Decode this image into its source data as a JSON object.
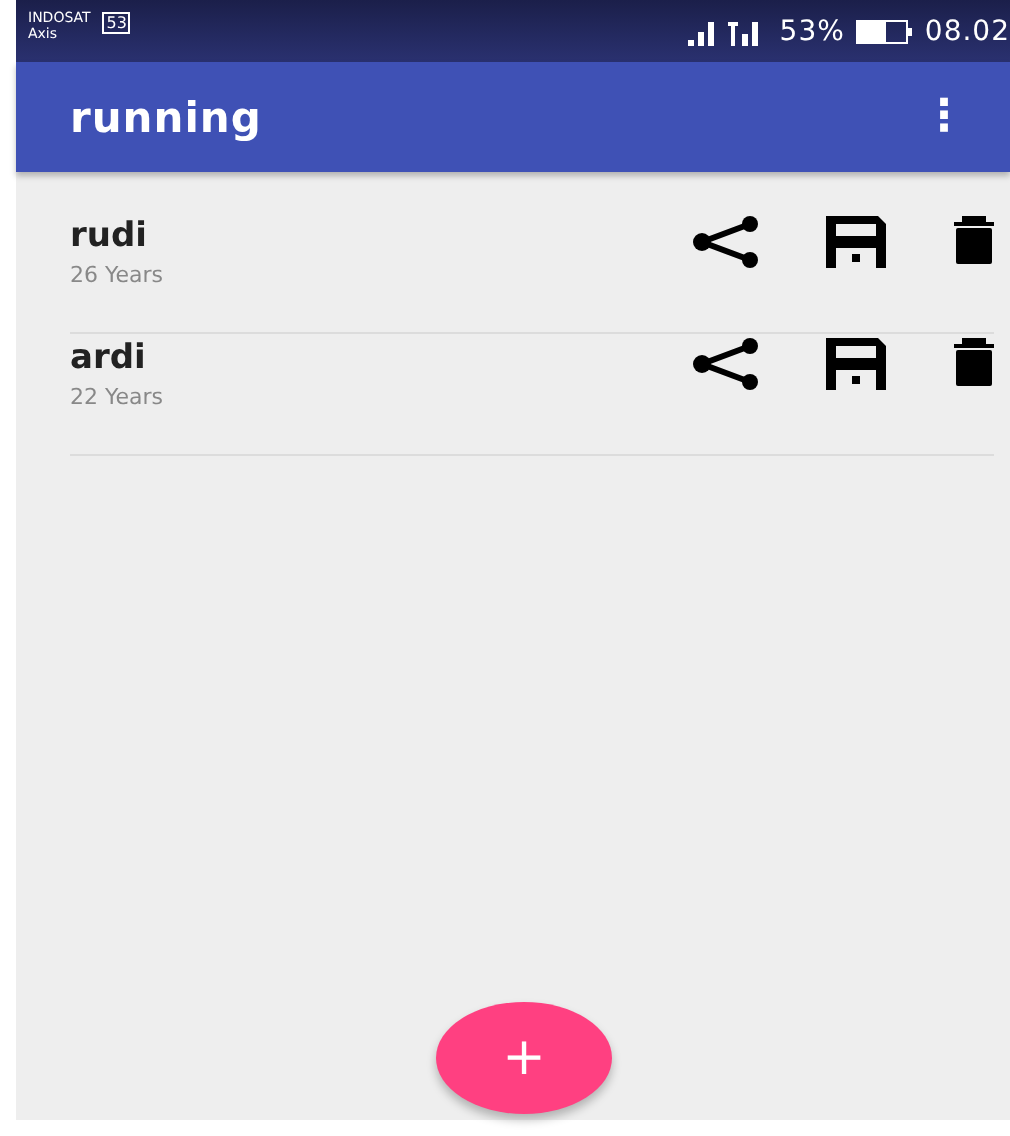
{
  "status_bar": {
    "carrier": "INDOSAT",
    "carrier_line_2": "Axis",
    "sim_badge": "53",
    "battery": "53%",
    "time": "08.02"
  },
  "app_bar": {
    "title": "running",
    "menu": "⋮"
  },
  "people": [
    {
      "name": "rudi",
      "age": "26 Years"
    },
    {
      "name": "ardi",
      "age": "22 Years"
    }
  ],
  "fab": {
    "label": "+"
  }
}
